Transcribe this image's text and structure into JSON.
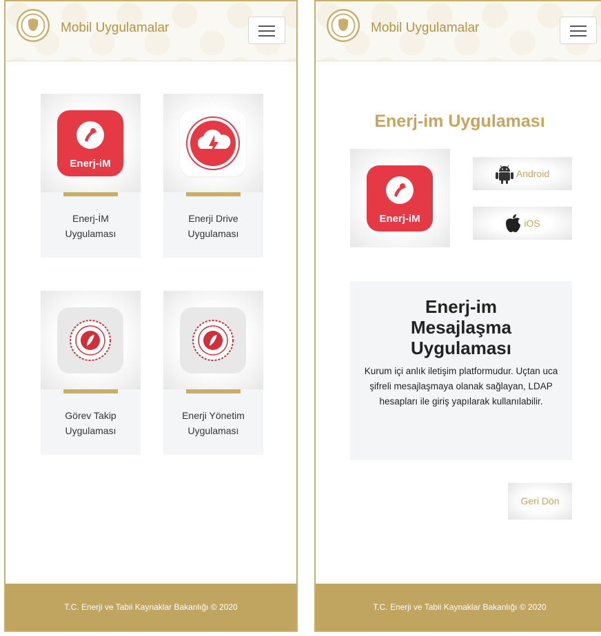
{
  "header": {
    "brand": "Mobil Uygulamalar"
  },
  "footer": {
    "text": "T.C. Enerji ve Tabii Kaynaklar Bakanlığı © 2020"
  },
  "apps": [
    {
      "name_line1": "Enerj-İM",
      "name_line2": "Uygulaması",
      "icon_label": "Enerj-iM"
    },
    {
      "name_line1": "Enerji Drive",
      "name_line2": "Uygulaması"
    },
    {
      "name_line1": "Görev Takip",
      "name_line2": "Uygulaması"
    },
    {
      "name_line1": "Enerji Yönetim",
      "name_line2": "Uygulaması"
    }
  ],
  "detail": {
    "title": "Enerj-im Uygulaması",
    "icon_label": "Enerj-iM",
    "android_label": "Android",
    "ios_label": "iOS",
    "heading_line1": "Enerj-im",
    "heading_line2": "Mesajlaşma",
    "heading_line3": "Uygulaması",
    "description": "Kurum içi anlık iletişim platformudur. Uçtan uca şifreli mesajlaşmaya olanak sağlayan, LDAP hesapları ile giriş yapılarak kullanılabilir.",
    "back_label": "Geri Dön"
  },
  "colors": {
    "gold": "#c9ad6a",
    "red": "#e63946",
    "footer": "#c0a560"
  }
}
